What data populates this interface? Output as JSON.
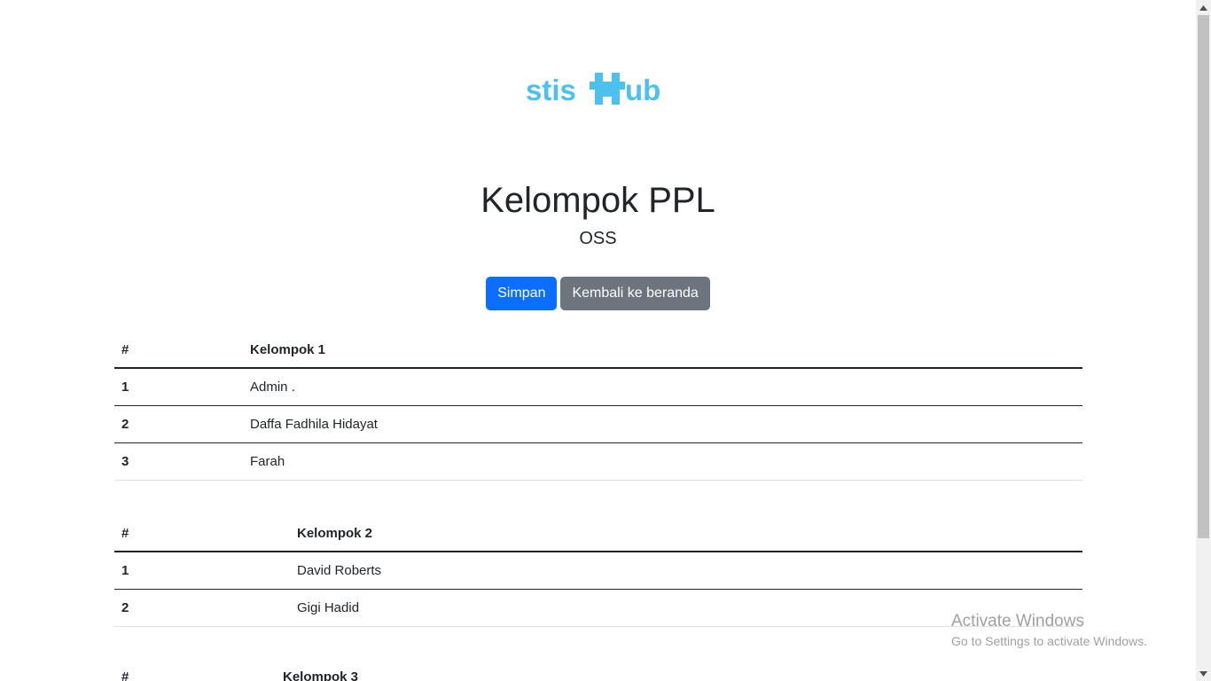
{
  "logo": {
    "text": "stisHub",
    "color": "#4cc0ee"
  },
  "header": {
    "title": "Kelompok PPL",
    "subtitle": "OSS"
  },
  "actions": {
    "save_label": "Simpan",
    "back_label": "Kembali ke beranda",
    "save_color": "#0d6efd",
    "back_color": "#6c757d"
  },
  "groups": [
    {
      "col_num": "#",
      "col_name": "Kelompok 1",
      "rows": [
        {
          "no": "1",
          "name": "Admin ."
        },
        {
          "no": "2",
          "name": "Daffa Fadhila Hidayat"
        },
        {
          "no": "3",
          "name": "Farah"
        }
      ]
    },
    {
      "col_num": "#",
      "col_name": "Kelompok 2",
      "rows": [
        {
          "no": "1",
          "name": "David Roberts"
        },
        {
          "no": "2",
          "name": "Gigi Hadid"
        }
      ]
    },
    {
      "col_num": "#",
      "col_name": "Kelompok 3",
      "rows": []
    }
  ],
  "watermark": {
    "line1": "Activate Windows",
    "line2": "Go to Settings to activate Windows."
  }
}
